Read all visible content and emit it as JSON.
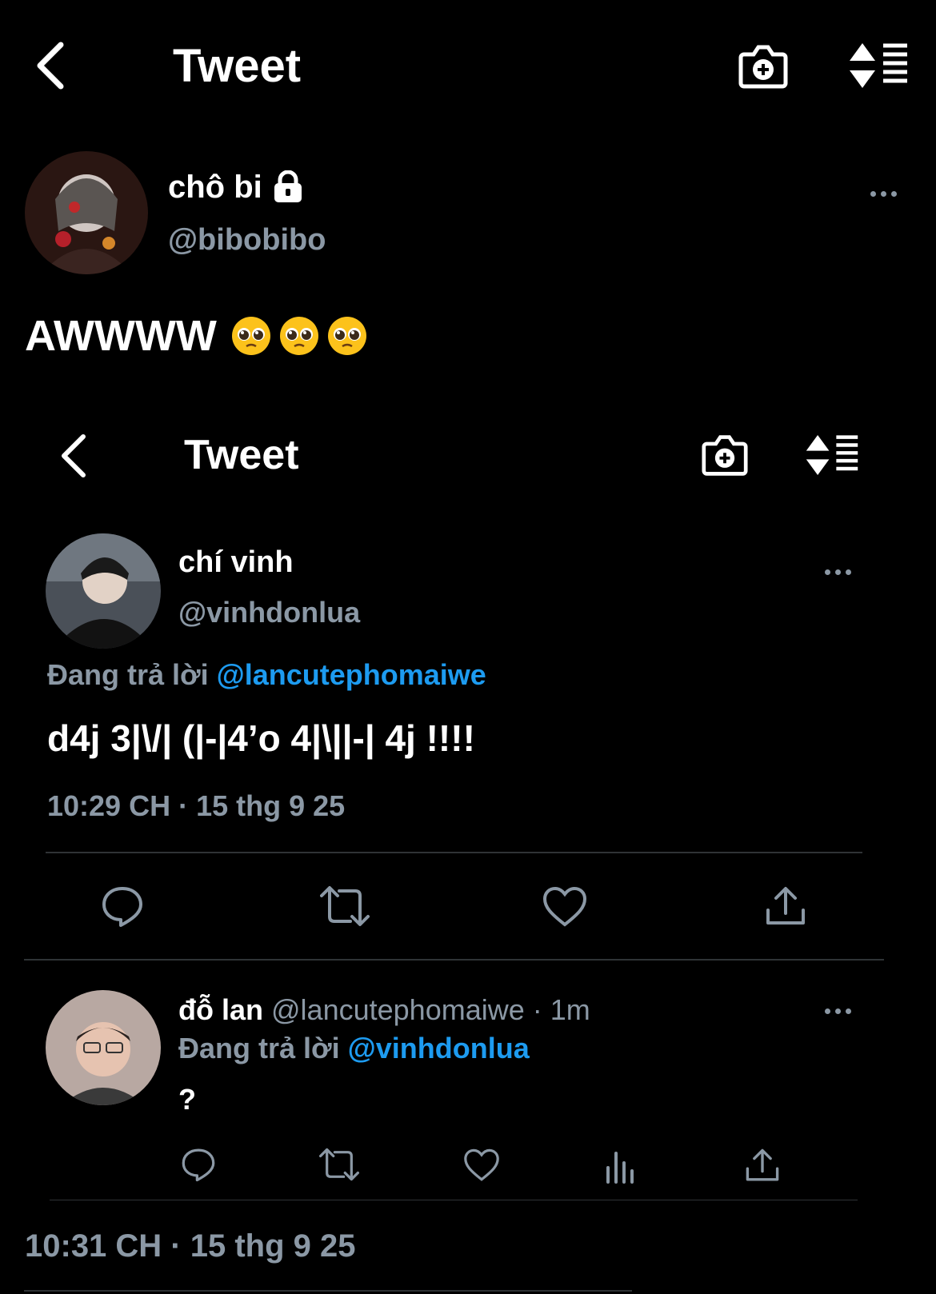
{
  "outer": {
    "header": {
      "title": "Tweet"
    },
    "author": {
      "name": "chô bi",
      "handle": "@bibobibo"
    },
    "text": "AWWWW",
    "emojis": [
      "pleading-face-emoji",
      "pleading-face-emoji",
      "pleading-face-emoji"
    ],
    "timestamp": "10:31 CH · 15 thg 9 25"
  },
  "inner": {
    "header": {
      "title": "Tweet"
    },
    "tweet": {
      "author": "chí vinh",
      "handle": "@vinhdonlua",
      "reply_prefix": "Đang trả lời",
      "reply_to": "@lancutephomaiwe",
      "text": "d4j 3|\\/| (|-|4’o 4|\\||-| 4j !!!!",
      "timestamp": "10:29 CH · 15 thg 9 25"
    },
    "reply": {
      "author": "đỗ lan",
      "handle": "@lancutephomaiwe",
      "separator": "·",
      "age": "1m",
      "reply_prefix": "Đang trả lời",
      "reply_to": "@vinhdonlua",
      "text": "?"
    }
  },
  "icons": [
    "back-arrow-icon",
    "add-photo-icon",
    "sort-icon",
    "lock-icon",
    "more-icon",
    "reply-icon",
    "retweet-icon",
    "like-icon",
    "share-icon",
    "analytics-icon"
  ],
  "colors": {
    "background": "#000000",
    "muted": "#8b98a5",
    "accent": "#1d9bf0",
    "divider": "#2f3336"
  }
}
